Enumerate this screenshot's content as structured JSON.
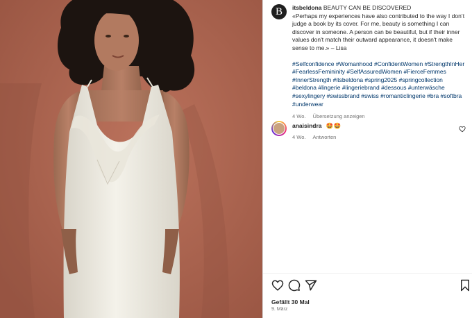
{
  "post": {
    "username": "itsbeldona",
    "avatar_letter": "B",
    "caption_title": "BEAUTY CAN BE DISCOVERED",
    "caption_quote": "«Perhaps my experiences have also contributed to the way I don’t judge a book by its cover. For me, beauty is something I can discover in someone. A person can be beautiful, but if their inner values don't match their outward appearance, it doesn't make sense to me.» – Lisa",
    "hashtags": "#Selfconfidence #Womanhood #ConfidentWomen #StrengthInHer #FearlessFemininity #SelfAssuredWomen #FierceFemmes #InnerStrength #itsbeldona #spring2025 #springcollection #beldona #lingerie #lingeriebrand #dessous #unterwäsche #sexylingery #swissbrand #swiss #romanticlingerie #bra #softbra #underwear",
    "age": "4 Wo.",
    "translate_label": "Übersetzung anzeigen"
  },
  "comment": {
    "username": "anaisindra",
    "text": "🤩🤩",
    "age": "4 Wo.",
    "reply_label": "Antworten",
    "like_icon": "heart-outline-icon"
  },
  "actions": {
    "like_icon": "heart-outline-icon",
    "comment_icon": "comment-bubble-icon",
    "share_icon": "paper-plane-icon",
    "save_icon": "bookmark-icon"
  },
  "likes_text": "Gefällt 30 Mal",
  "date_text": "9. März",
  "colors": {
    "hashtag": "#00376b",
    "secondary_text": "#737373",
    "background_wall": "#b06550"
  }
}
